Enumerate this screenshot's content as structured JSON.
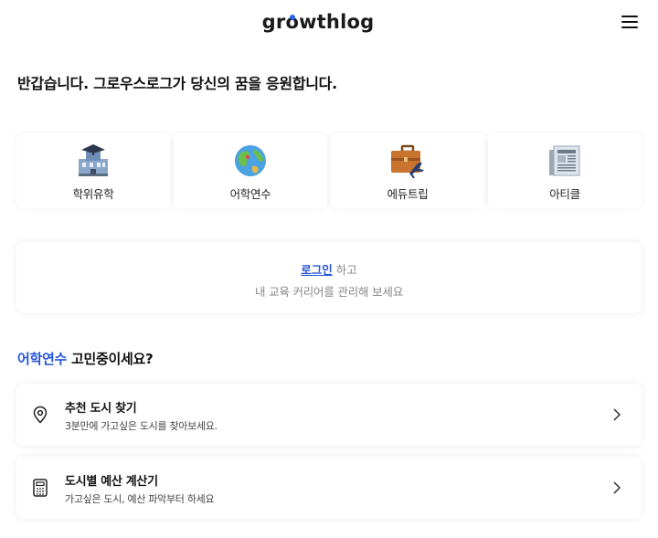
{
  "header": {
    "logo_pre": "gr",
    "logo_o": "o",
    "logo_post": "wthlog",
    "menu_icon": "hamburger-menu-icon"
  },
  "greeting": "반갑습니다. 그로우스로그가 당신의 꿈을 응원합니다.",
  "categories": [
    {
      "label": "학위유학",
      "icon": "university-building-icon"
    },
    {
      "label": "어학연수",
      "icon": "globe-icon"
    },
    {
      "label": "에듀트립",
      "icon": "briefcase-airplane-icon"
    },
    {
      "label": "아티클",
      "icon": "newspaper-icon"
    }
  ],
  "login": {
    "link_label": "로그인",
    "line1_suffix": " 하고",
    "line2": "내 교육 커리어를 관리해 보세요"
  },
  "section": {
    "accent": "어학연수",
    "rest": " 고민중이세요?"
  },
  "items": [
    {
      "title": "추천 도시 찾기",
      "subtitle": "3분만에 가고싶은 도시를 찾아보세요.",
      "icon": "location-pin-icon"
    },
    {
      "title": "도시별 예산 계산기",
      "subtitle": "가고싶은 도시, 예산 파악부터 하세요",
      "icon": "calculator-icon"
    }
  ],
  "colors": {
    "accent": "#2554d6",
    "text": "#111111",
    "muted": "#888888"
  }
}
